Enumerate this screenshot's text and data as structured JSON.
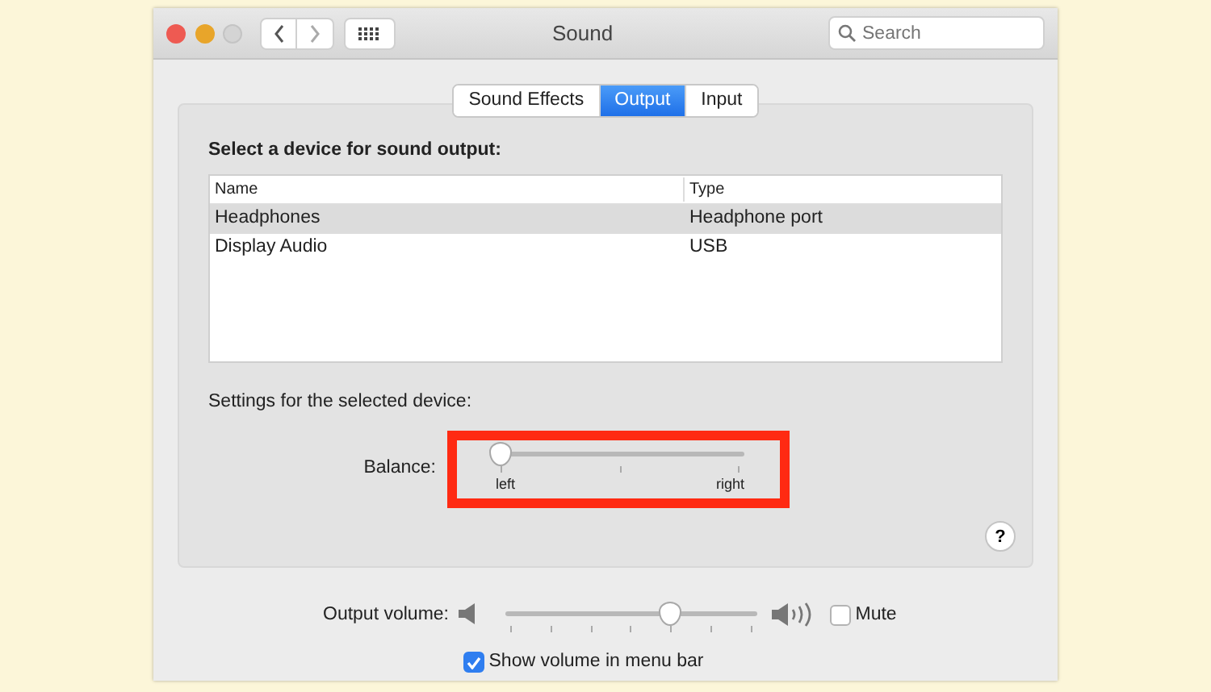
{
  "window": {
    "title": "Sound"
  },
  "search": {
    "placeholder": "Search"
  },
  "tabs": [
    {
      "label": "Sound Effects",
      "selected": false
    },
    {
      "label": "Output",
      "selected": true
    },
    {
      "label": "Input",
      "selected": false
    }
  ],
  "device_heading": "Select a device for sound output:",
  "table": {
    "columns": [
      "Name",
      "Type"
    ],
    "rows": [
      {
        "cells": [
          "Headphones",
          "Headphone port"
        ],
        "selected": true
      },
      {
        "cells": [
          "Display Audio",
          "USB"
        ],
        "selected": false
      }
    ]
  },
  "settings_heading": "Settings for the selected device:",
  "balance": {
    "label": "Balance:",
    "level": 0,
    "min_label": "left",
    "max_label": "right",
    "highlighted": true
  },
  "help": "?",
  "output_volume": {
    "label": "Output volume:",
    "level": 0.66
  },
  "mute": {
    "label": "Mute",
    "checked": false
  },
  "show_volume": {
    "label": "Show volume in menu bar",
    "checked": true
  }
}
